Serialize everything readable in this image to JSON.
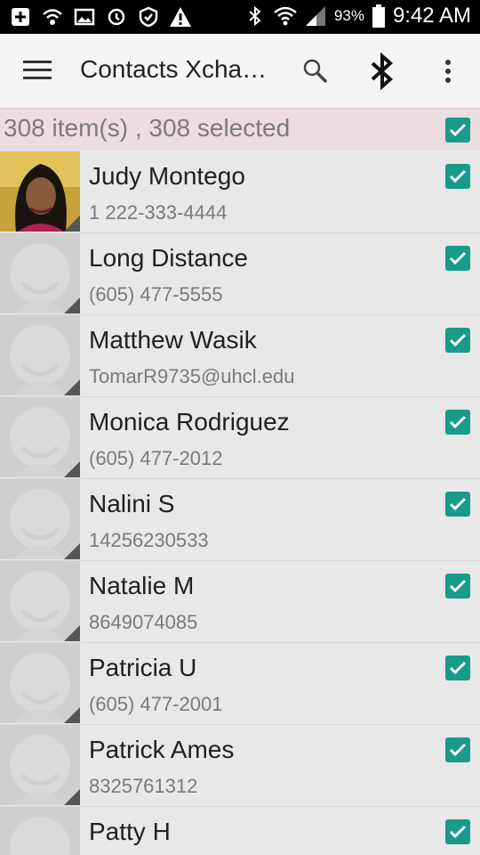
{
  "status_bar": {
    "left_icons": [
      "add-box-icon",
      "wifi-call-icon",
      "image-icon",
      "sync-icon",
      "shield-icon",
      "warning-icon"
    ],
    "battery_percent": "93%",
    "time": "9:42 AM"
  },
  "toolbar": {
    "title": "Contacts Xcha…",
    "icons": [
      "menu-icon",
      "search-icon",
      "bluetooth-icon",
      "more-vert-icon"
    ]
  },
  "selection": {
    "summary": "308 item(s) , 308 selected",
    "all_checked": true
  },
  "contacts": [
    {
      "name": "Judy Montego",
      "detail": "1 222-333-4444",
      "has_photo": true,
      "checked": true
    },
    {
      "name": "Long Distance",
      "detail": "(605) 477-5555",
      "has_photo": false,
      "checked": true
    },
    {
      "name": "Matthew Wasik",
      "detail": "TomarR9735@uhcl.edu",
      "has_photo": false,
      "checked": true
    },
    {
      "name": "Monica Rodriguez",
      "detail": "(605) 477-2012",
      "has_photo": false,
      "checked": true
    },
    {
      "name": "Nalini S",
      "detail": "14256230533",
      "has_photo": false,
      "checked": true
    },
    {
      "name": "Natalie M",
      "detail": "8649074085",
      "has_photo": false,
      "checked": true
    },
    {
      "name": "Patricia U",
      "detail": "(605) 477-2001",
      "has_photo": false,
      "checked": true
    },
    {
      "name": "Patrick Ames",
      "detail": "8325761312",
      "has_photo": false,
      "checked": true
    },
    {
      "name": "Patty H",
      "detail": "",
      "has_photo": false,
      "checked": true
    }
  ],
  "colors": {
    "accent": "#1a9a8a",
    "selection_header_bg": "#ecdde1",
    "list_bg": "#e8e8e8"
  }
}
